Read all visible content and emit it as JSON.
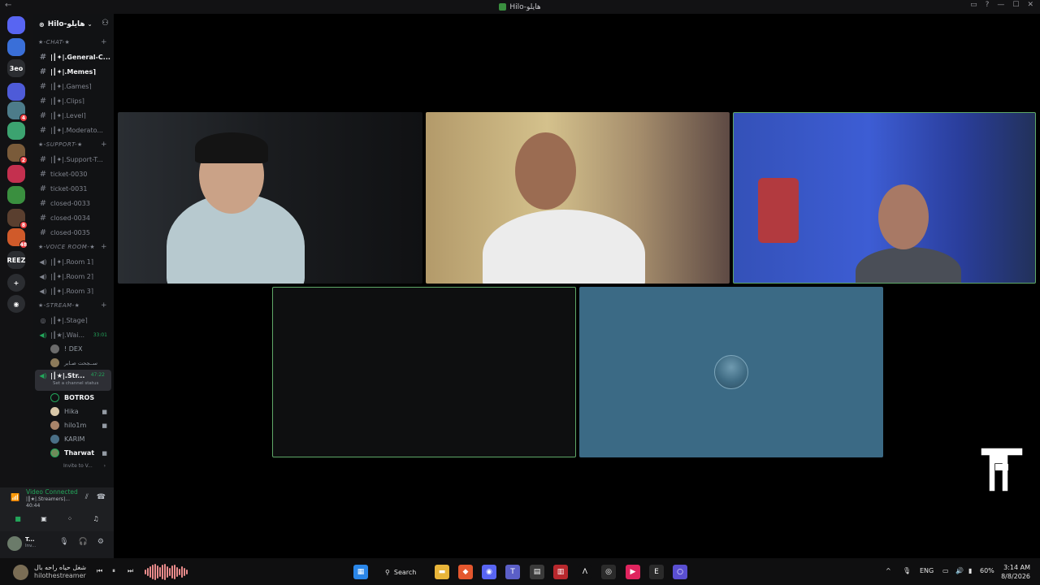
{
  "window": {
    "title": "Hilo-هايلو"
  },
  "server_rail": {
    "items": [
      {
        "name": "discord-home",
        "badge": "",
        "color": "#5865f2",
        "label": ""
      },
      {
        "name": "server-1",
        "badge": "",
        "color": "#3a6fd8",
        "label": ""
      },
      {
        "name": "server-3eo",
        "badge": "",
        "color": "#2b2d31",
        "label": "3eo"
      },
      {
        "name": "server-4",
        "badge": "",
        "color": "#4e5bd8",
        "label": ""
      },
      {
        "name": "server-5",
        "badge": "4",
        "color": "#4d7c8a",
        "label": ""
      },
      {
        "name": "server-6",
        "badge": "",
        "color": "#3ca370",
        "label": ""
      },
      {
        "name": "server-7",
        "badge": "2",
        "color": "#7a5b3a",
        "label": ""
      },
      {
        "name": "server-8",
        "badge": "",
        "color": "#c4304f",
        "label": ""
      },
      {
        "name": "server-hilo",
        "badge": "",
        "color": "#3a8f3f",
        "label": ""
      },
      {
        "name": "server-10",
        "badge": "8",
        "color": "#5a3f2f",
        "label": ""
      },
      {
        "name": "server-11",
        "badge": "48",
        "color": "#d05a2a",
        "label": ""
      },
      {
        "name": "server-reez",
        "badge": "",
        "color": "#2b2d31",
        "label": "REEZ"
      }
    ]
  },
  "sidebar": {
    "server_name": "Hilo-هايلو",
    "categories": {
      "chat": "★-CHAT-★",
      "support": "★-SUPPORT-★",
      "voice": "★-VOICE ROOM-★",
      "stream": "★-STREAM-★"
    },
    "chat_channels": [
      {
        "label": "|┃✦|.General-C...",
        "bright": true
      },
      {
        "label": "|┃✦|.Memes⌉",
        "bright": true
      },
      {
        "label": "|┃✦|.Games⌉",
        "bright": false
      },
      {
        "label": "|┃✦|.Clips⌉",
        "bright": false
      },
      {
        "label": "|┃✦|.Level⌉",
        "bright": false
      },
      {
        "label": "|┃✦|.Moderato...",
        "bright": false
      }
    ],
    "support_channels": [
      {
        "label": "|┃✦|.Support-T..."
      },
      {
        "label": "ticket-0030"
      },
      {
        "label": "ticket-0031"
      },
      {
        "label": "closed-0033"
      },
      {
        "label": "closed-0034"
      },
      {
        "label": "closed-0035"
      }
    ],
    "voice_channels": [
      {
        "label": "|┃✦|.Room 1⌉"
      },
      {
        "label": "|┃✦|.Room 2⌉"
      },
      {
        "label": "|┃✦|.Room 3⌉"
      }
    ],
    "stream": {
      "stage": "|┃✦|.Stage⌉",
      "waiting": "|┃★|.Wai...",
      "waiting_timer": "33:01",
      "waiting_users": [
        "! DEX",
        "ســجحت صـابر"
      ],
      "streamers": "|┃★|.Str...",
      "streamers_timer": "47:22",
      "streamers_status": "Set a channel status",
      "streamers_users": [
        {
          "name": "BOTROS",
          "speaking": true,
          "cam": false
        },
        {
          "name": "Hika",
          "speaking": false,
          "cam": true
        },
        {
          "name": "hilo1m",
          "speaking": false,
          "cam": true
        },
        {
          "name": "KARIM",
          "speaking": false,
          "cam": false
        },
        {
          "name": "Tharwat",
          "speaking": true,
          "cam": true
        }
      ],
      "invite": "Invite to V..."
    }
  },
  "voice_panel": {
    "title": "Video Connected",
    "channel": "|┃★|.Streamers⌉...",
    "time": "40:44"
  },
  "user_panel": {
    "name": "T...",
    "status": "Inv..."
  },
  "taskbar": {
    "media_title": "شغل حياه راحه بال",
    "media_artist": "hilothestreamer",
    "search": "Search",
    "lang": "ENG",
    "battery": "60%",
    "time": "3:14 AM",
    "date": "8/8/2026"
  }
}
